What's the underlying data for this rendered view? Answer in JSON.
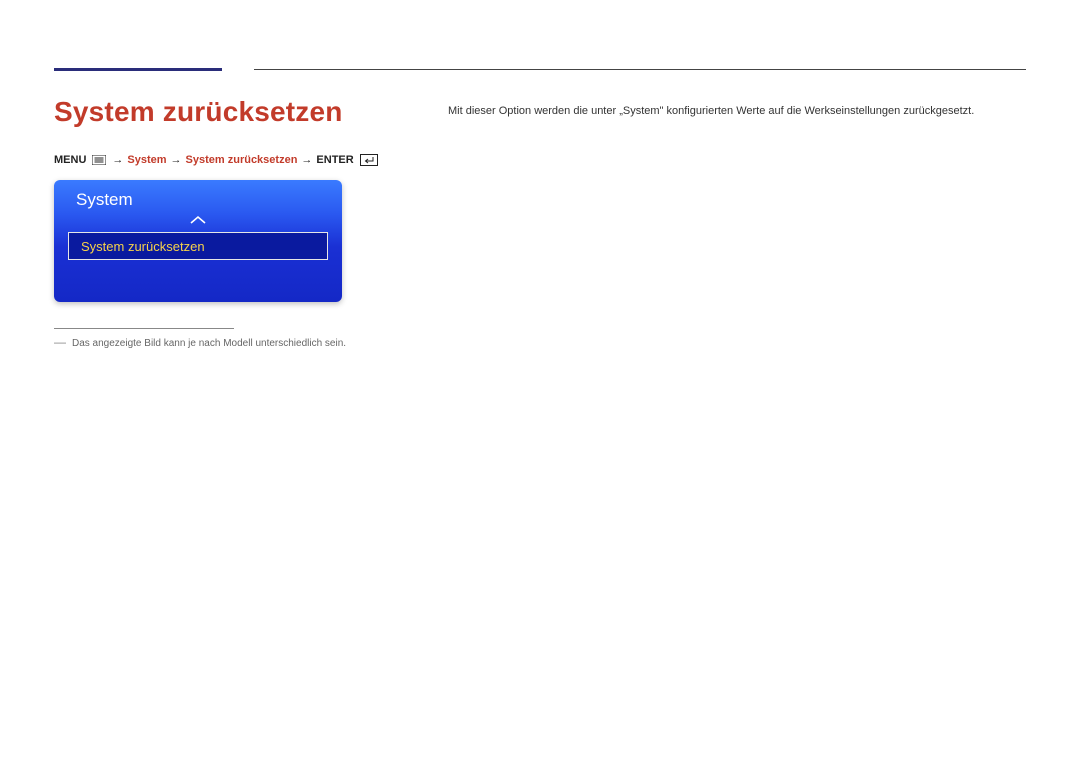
{
  "header": {
    "title": "System zurücksetzen"
  },
  "description": "Mit dieser Option werden die unter „System\" konfigurierten Werte auf die Werkseinstellungen zurückgesetzt.",
  "breadcrumb": {
    "menu": "MENU",
    "arrow": "→",
    "segment1": "System",
    "segment2": "System zurücksetzen",
    "enter": "ENTER"
  },
  "osd": {
    "title": "System",
    "selected_item": "System zurücksetzen"
  },
  "footnote": {
    "dash": "―",
    "text": "Das angezeigte Bild kann je nach Modell unterschiedlich sein."
  }
}
